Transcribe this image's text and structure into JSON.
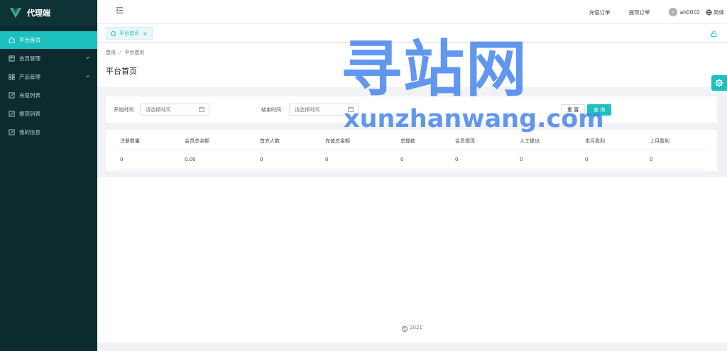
{
  "app": {
    "title": "代理端"
  },
  "sidebar": {
    "items": [
      {
        "label": "平台首页",
        "icon": "home-icon",
        "active": true
      },
      {
        "label": "会员管理",
        "icon": "grid-icon",
        "expandable": true
      },
      {
        "label": "产品管理",
        "icon": "apps-icon",
        "expandable": true
      },
      {
        "label": "充值列表",
        "icon": "edit-icon"
      },
      {
        "label": "提现列表",
        "icon": "edit-icon"
      },
      {
        "label": "我的信息",
        "icon": "edit-icon"
      }
    ]
  },
  "topbar": {
    "recharge_order": "充值订单",
    "withdraw_order": "提现订单",
    "username": "ah0002",
    "language": "简体"
  },
  "tabs": [
    {
      "label": "平台首页",
      "close": "×"
    }
  ],
  "breadcrumb": {
    "home": "首页",
    "sep": "/",
    "current": "平台首页"
  },
  "page": {
    "title": "平台首页"
  },
  "filter": {
    "start_label": "开始时间:",
    "start_placeholder": "请选择时间",
    "end_label": "结束时间:",
    "end_placeholder": "请选择时间",
    "reset": "重 置",
    "query": "查 询"
  },
  "table": {
    "headers": [
      "注册数量",
      "会员总余额",
      "首充人数",
      "充值总金额",
      "总提款",
      "会员提现",
      "人工提出",
      "本月盈利",
      "上月盈利"
    ],
    "rows": [
      [
        "0",
        "0.00",
        "0",
        "0",
        "0",
        "0",
        "0",
        "0",
        "0"
      ]
    ]
  },
  "footer": {
    "copyright_symbol": "C",
    "year": "2021"
  },
  "watermark": {
    "cn": "寻站网",
    "en": "xunzhanwang.com"
  },
  "colors": {
    "accent": "#1cc0be",
    "sidebar_bg": "#0b2b2f",
    "watermark": "#4080eb"
  }
}
